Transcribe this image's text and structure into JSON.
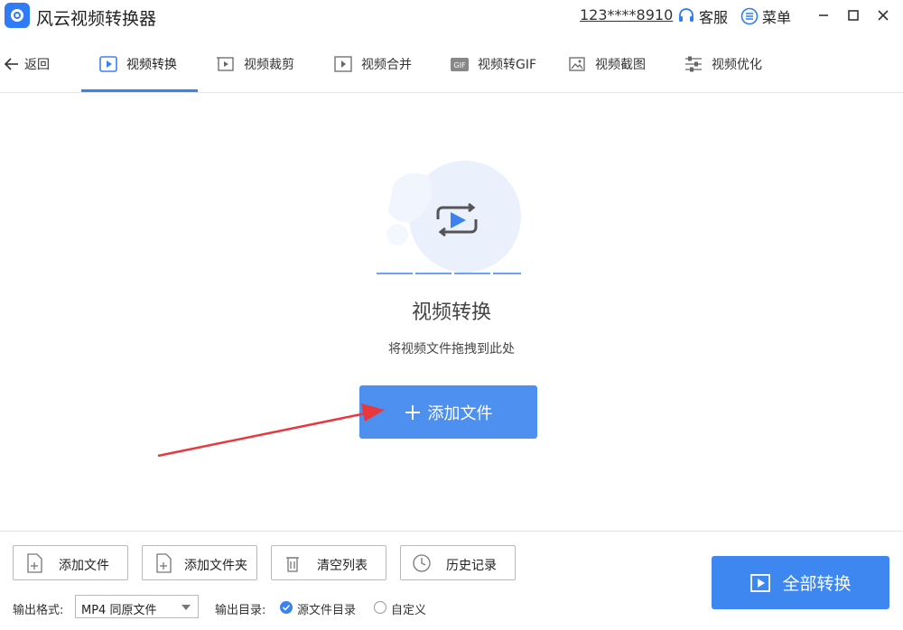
{
  "app": {
    "title": "风云视频转换器"
  },
  "titlebar": {
    "account": "123****8910",
    "service_label": "客服",
    "menu_label": "菜单"
  },
  "nav": {
    "back_label": "返回",
    "tabs": [
      {
        "label": "视频转换",
        "icon": "video-convert-icon",
        "active": true
      },
      {
        "label": "视频裁剪",
        "icon": "video-crop-icon"
      },
      {
        "label": "视频合并",
        "icon": "video-merge-icon"
      },
      {
        "label": "视频转GIF",
        "icon": "gif-icon"
      },
      {
        "label": "视频截图",
        "icon": "screenshot-icon"
      },
      {
        "label": "视频优化",
        "icon": "optimize-icon"
      }
    ]
  },
  "main": {
    "title": "视频转换",
    "subtitle": "将视频文件拖拽到此处",
    "add_button": "添加文件"
  },
  "toolbar": {
    "add_file": "添加文件",
    "add_folder": "添加文件夹",
    "clear_list": "清空列表",
    "history": "历史记录"
  },
  "output": {
    "format_label": "输出格式:",
    "format_value": "MP4 同原文件",
    "dir_label": "输出目录:",
    "dir_options": [
      "源文件目录",
      "自定义"
    ],
    "dir_selected": "源文件目录"
  },
  "convert_all_label": "全部转换",
  "colors": {
    "accent": "#3e86f0",
    "annotation_arrow": "#e8383d"
  }
}
